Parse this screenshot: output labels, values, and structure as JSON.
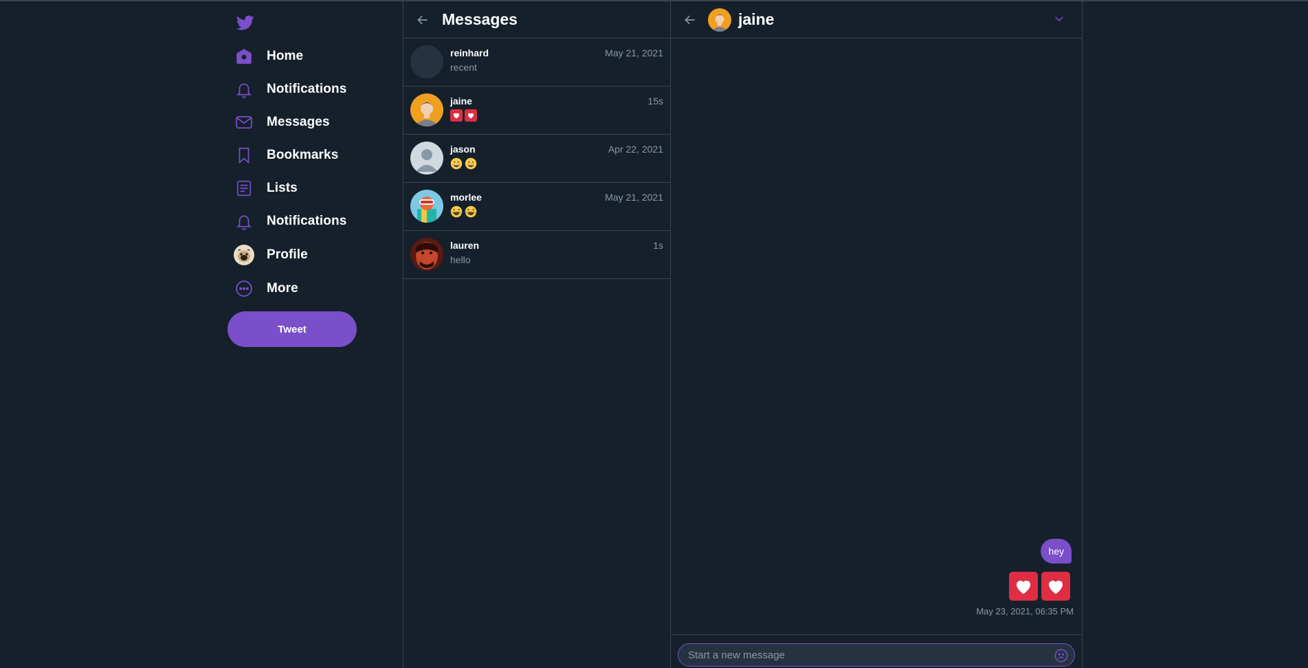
{
  "colors": {
    "accent": "#7a4fc9",
    "background": "#15202b",
    "border": "#38444d",
    "muted": "#8899a6"
  },
  "sidebar": {
    "logo": "twitter-bird-icon",
    "items": [
      {
        "label": "Home",
        "icon": "home-icon"
      },
      {
        "label": "Notifications",
        "icon": "bell-icon"
      },
      {
        "label": "Messages",
        "icon": "envelope-icon"
      },
      {
        "label": "Bookmarks",
        "icon": "bookmark-icon"
      },
      {
        "label": "Lists",
        "icon": "list-icon"
      },
      {
        "label": "Notifications",
        "icon": "bell-icon"
      },
      {
        "label": "Profile",
        "icon": "avatar"
      },
      {
        "label": "More",
        "icon": "more-icon"
      }
    ],
    "tweet_label": "Tweet"
  },
  "messages": {
    "title": "Messages",
    "conversations": [
      {
        "name": "reinhard",
        "preview": "recent",
        "time": "May 21, 2021"
      },
      {
        "name": "jaine",
        "preview": "heart-emoji heart-emoji",
        "time": "15s"
      },
      {
        "name": "jason",
        "preview": "grinning-emoji grinning-emoji",
        "time": "Apr 22, 2021"
      },
      {
        "name": "morlee",
        "preview": "laughing-emoji laughing-emoji",
        "time": "May 21, 2021"
      },
      {
        "name": "lauren",
        "preview": "hello",
        "time": "1s"
      }
    ]
  },
  "chat": {
    "name": "jaine",
    "bubble_text": "hey",
    "timestamp": "May 23, 2021, 06:35 PM",
    "composer_placeholder": "Start a new message"
  }
}
